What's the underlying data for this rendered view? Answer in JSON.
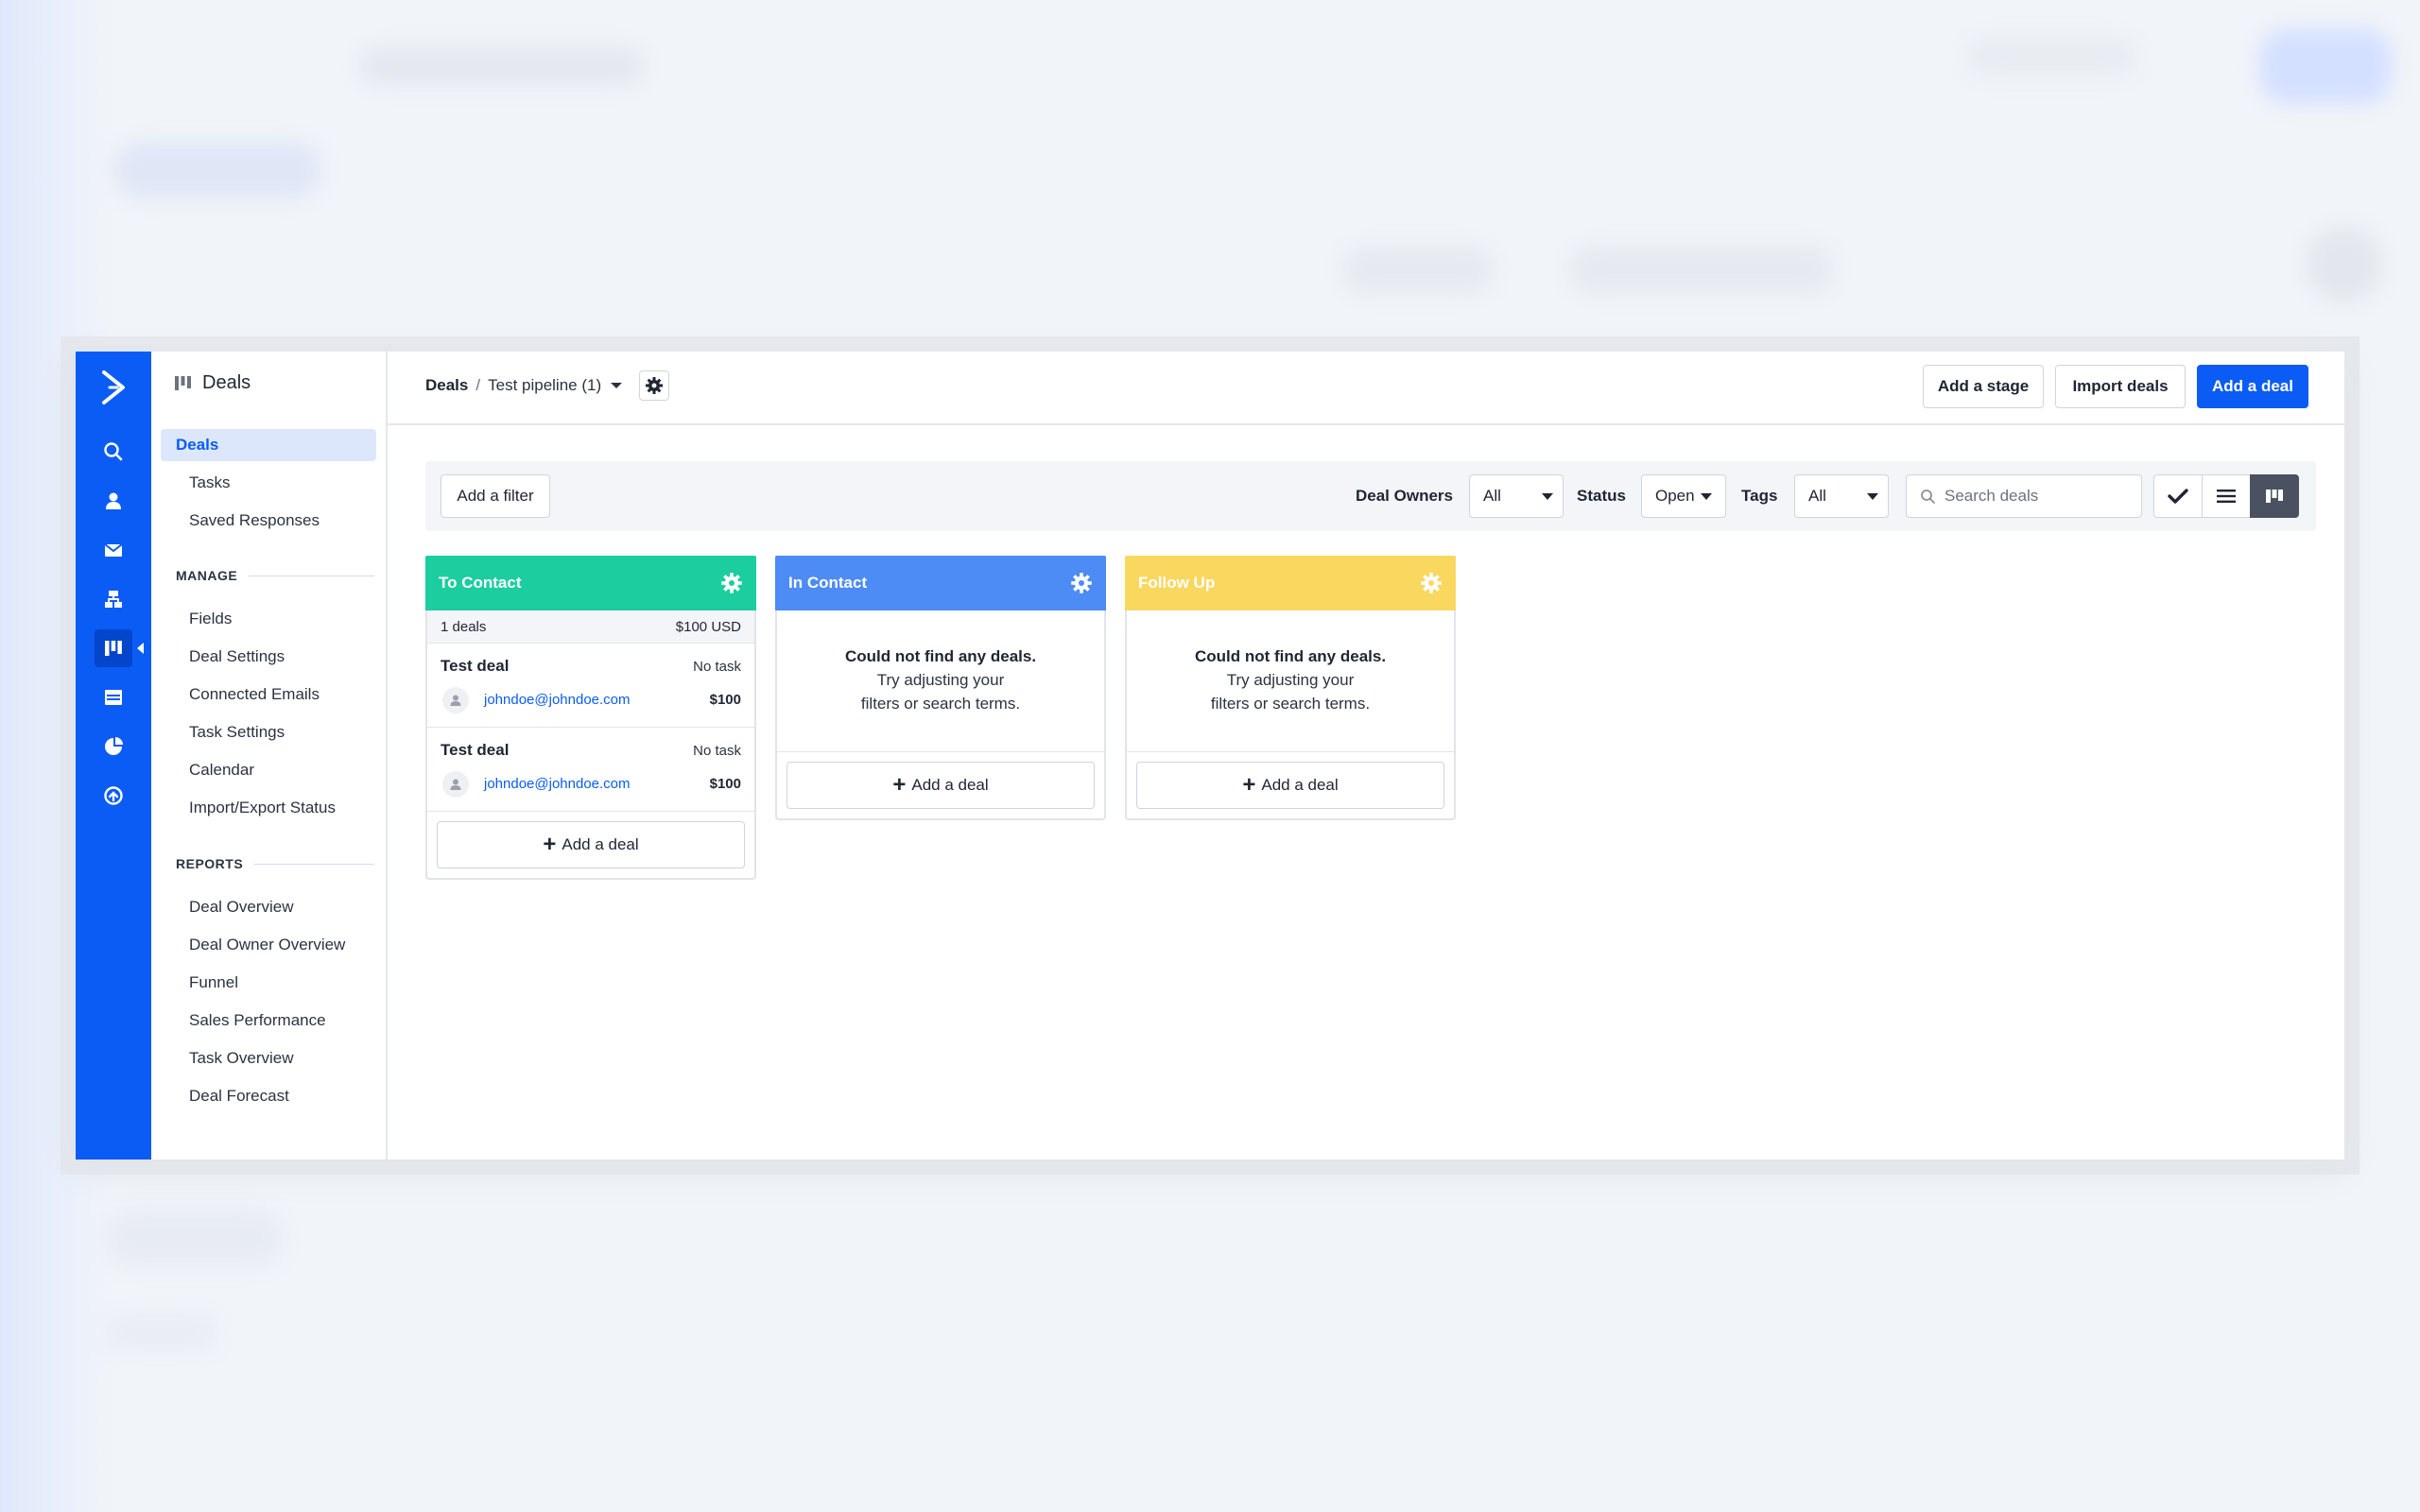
{
  "colors": {
    "brand": "#0a5cf5",
    "stage_to_contact": "#1ccd9f",
    "stage_in_contact": "#4d8bf5",
    "stage_follow_up": "#fad75f"
  },
  "rail": {
    "icons": [
      "logo-icon",
      "search-icon",
      "contacts-icon",
      "email-icon",
      "automations-icon",
      "deals-icon",
      "website-icon",
      "reports-icon",
      "upgrade-icon"
    ]
  },
  "subnav": {
    "title": "Deals",
    "items": [
      "Deals",
      "Tasks",
      "Saved Responses"
    ],
    "manage_label": "MANAGE",
    "manage_items": [
      "Fields",
      "Deal Settings",
      "Connected Emails",
      "Task Settings",
      "Calendar",
      "Import/Export Status"
    ],
    "reports_label": "REPORTS",
    "reports_items": [
      "Deal Overview",
      "Deal Owner Overview",
      "Funnel",
      "Sales Performance",
      "Task Overview",
      "Deal Forecast"
    ]
  },
  "header": {
    "crumb_root": "Deals",
    "crumb_sep": "/",
    "pipeline": "Test pipeline (1)",
    "add_stage": "Add a stage",
    "import_deals": "Import deals",
    "add_deal": "Add a deal"
  },
  "filters": {
    "add_filter": "Add a filter",
    "owners_label": "Deal Owners",
    "owners_value": "All",
    "status_label": "Status",
    "status_value": "Open",
    "tags_label": "Tags",
    "tags_value": "All",
    "search_placeholder": "Search deals"
  },
  "stages": [
    {
      "name": "To Contact",
      "summary_count": "1 deals",
      "summary_total": "$100 USD",
      "deals": [
        {
          "title": "Test deal",
          "task": "No task",
          "email": "johndoe@johndoe.com",
          "amount": "$100"
        },
        {
          "title": "Test deal",
          "task": "No task",
          "email": "johndoe@johndoe.com",
          "amount": "$100"
        }
      ],
      "add_label": "Add a deal"
    },
    {
      "name": "In Contact",
      "empty_title": "Could not find any deals.",
      "empty_line1": "Try adjusting your",
      "empty_line2": "filters or search terms.",
      "add_label": "Add a deal"
    },
    {
      "name": "Follow Up",
      "empty_title": "Could not find any deals.",
      "empty_line1": "Try adjusting your",
      "empty_line2": "filters or search terms.",
      "add_label": "Add a deal"
    }
  ]
}
